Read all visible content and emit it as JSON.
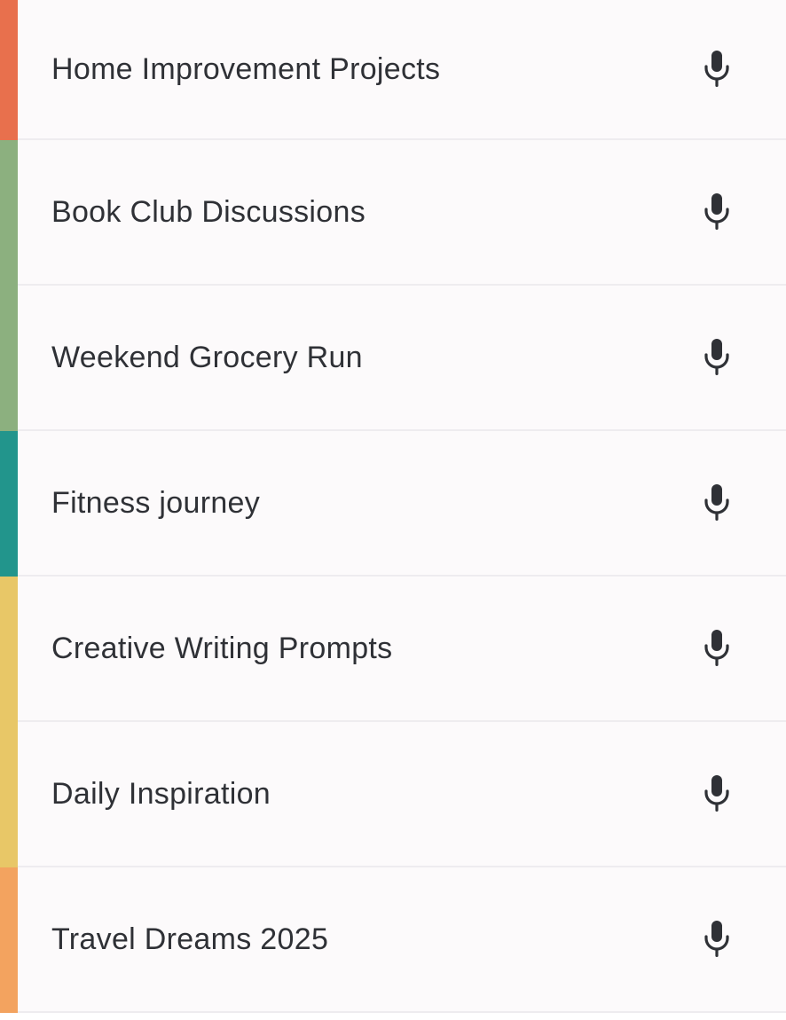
{
  "notes": [
    {
      "title": "Home Improvement Projects",
      "color": "#e8704d",
      "icon": "microphone-icon"
    },
    {
      "title": "Book Club Discussions",
      "color": "#8cb07f",
      "icon": "microphone-icon"
    },
    {
      "title": "Weekend Grocery Run",
      "color": "#8cb07f",
      "icon": "microphone-icon"
    },
    {
      "title": "Fitness journey",
      "color": "#22958c",
      "icon": "microphone-icon"
    },
    {
      "title": "Creative Writing Prompts",
      "color": "#e8c767",
      "icon": "microphone-icon"
    },
    {
      "title": "Daily Inspiration",
      "color": "#e8c767",
      "icon": "microphone-icon"
    },
    {
      "title": "Travel Dreams 2025",
      "color": "#f3a35f",
      "icon": "microphone-icon"
    }
  ]
}
